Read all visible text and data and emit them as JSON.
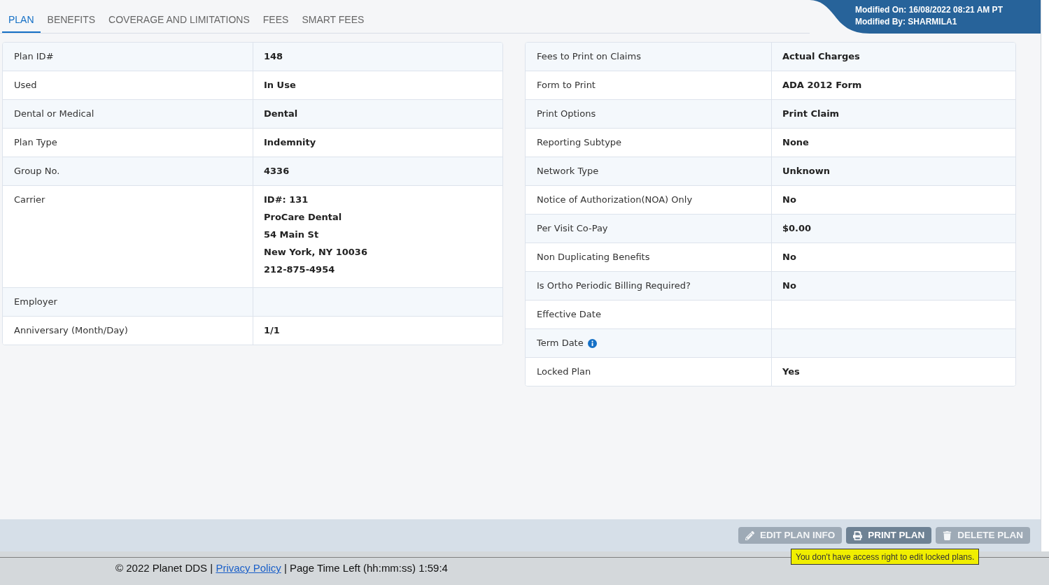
{
  "tabs": [
    {
      "label": "PLAN",
      "selected": true
    },
    {
      "label": "BENEFITS",
      "selected": false
    },
    {
      "label": "COVERAGE AND LIMITATIONS",
      "selected": false
    },
    {
      "label": "FEES",
      "selected": false
    },
    {
      "label": "SMART FEES",
      "selected": false
    }
  ],
  "modified": {
    "on": "Modified On: 16/08/2022 08:21 AM PT",
    "by": "Modified By: SHARMILA1"
  },
  "left_table": {
    "rows": [
      {
        "label": "Plan ID#",
        "value": "148"
      },
      {
        "label": "Used",
        "value": "In Use"
      },
      {
        "label": "Dental or Medical",
        "value": "Dental"
      },
      {
        "label": "Plan Type",
        "value": "Indemnity"
      },
      {
        "label": "Group No.",
        "value": "4336"
      },
      {
        "label": "Carrier",
        "value": [
          "ID#: 131",
          "ProCare Dental",
          "54 Main St",
          "New York, NY 10036",
          "212-875-4954"
        ]
      },
      {
        "label": "Employer"
      },
      {
        "label": "Anniversary (Month/Day)",
        "value": "1/1"
      }
    ]
  },
  "right_table": {
    "rows": [
      {
        "label": "Fees to Print on Claims",
        "value": "Actual Charges"
      },
      {
        "label": "Form to Print",
        "value": "ADA 2012 Form"
      },
      {
        "label": "Print Options",
        "value": "Print Claim"
      },
      {
        "label": "Reporting Subtype",
        "value": "None"
      },
      {
        "label": "Network Type",
        "value": "Unknown"
      },
      {
        "label": "Notice of Authorization(NOA) Only",
        "value": "No"
      },
      {
        "label": "Per Visit Co-Pay",
        "value": "$0.00"
      },
      {
        "label": "Non Duplicating Benefits",
        "value": "No"
      },
      {
        "label": "Is Ortho Periodic Billing Required?",
        "value": "No"
      },
      {
        "label": "Effective Date"
      },
      {
        "label": "Term Date",
        "help_icon": true
      },
      {
        "label": "Locked Plan",
        "value": "Yes"
      }
    ]
  },
  "actions": [
    {
      "kind": "edit",
      "label": "EDIT PLAN INFO",
      "disabled": true
    },
    {
      "kind": "print",
      "label": "PRINT PLAN",
      "disabled": false
    },
    {
      "kind": "delete",
      "label": "DELETE PLAN",
      "disabled": true
    }
  ],
  "tooltip": "You don't have access right to edit locked plans.",
  "footer": {
    "before": "© 2022 Planet DDS |",
    "link": "Privacy Policy",
    "after": "|  Page Time Left (hh:mm:ss) 1:59:4"
  }
}
